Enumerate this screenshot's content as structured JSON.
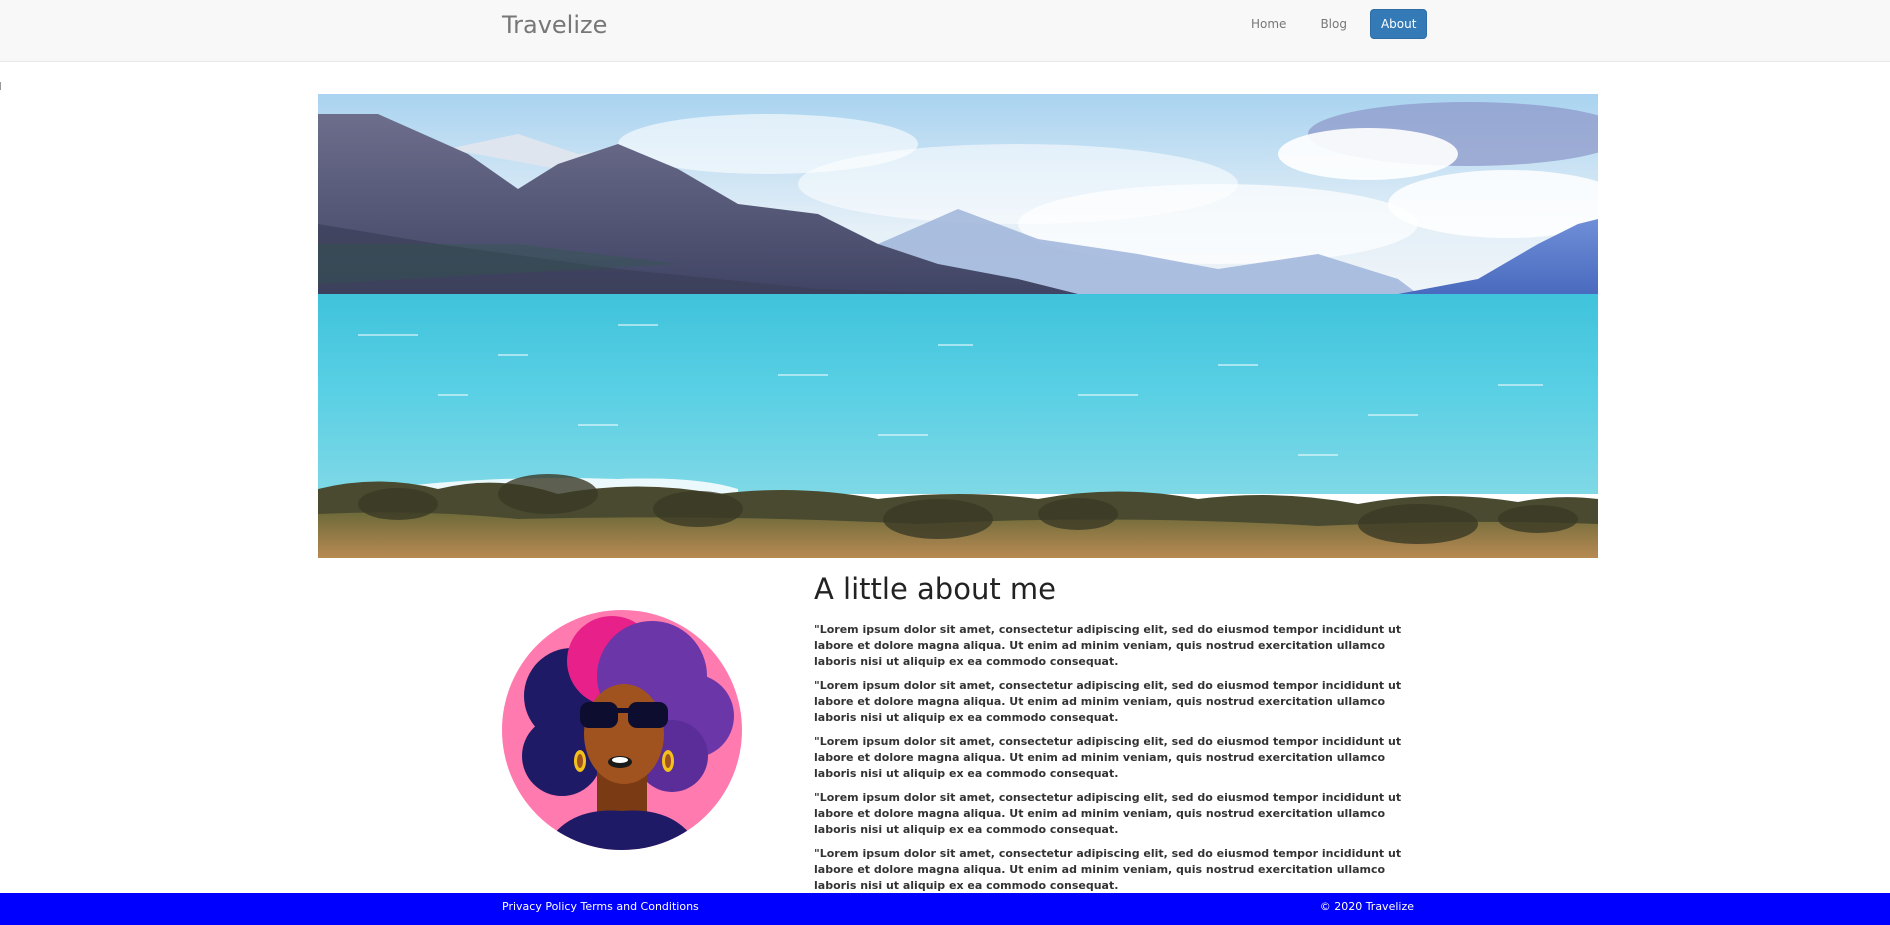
{
  "navbar": {
    "brand": "Travelize",
    "links": [
      "Home",
      "Blog",
      "About"
    ]
  },
  "about": {
    "title": "A little about me",
    "paragraphs": [
      "\"Lorem ipsum dolor sit amet, consectetur adipiscing elit, sed do eiusmod tempor incididunt ut labore et dolore magna aliqua. Ut enim ad minim veniam, quis nostrud exercitation ullamco laboris nisi ut aliquip ex ea commodo consequat.",
      "\"Lorem ipsum dolor sit amet, consectetur adipiscing elit, sed do eiusmod tempor incididunt ut labore et dolore magna aliqua. Ut enim ad minim veniam, quis nostrud exercitation ullamco laboris nisi ut aliquip ex ea commodo consequat.",
      "\"Lorem ipsum dolor sit amet, consectetur adipiscing elit, sed do eiusmod tempor incididunt ut labore et dolore magna aliqua. Ut enim ad minim veniam, quis nostrud exercitation ullamco laboris nisi ut aliquip ex ea commodo consequat.",
      "\"Lorem ipsum dolor sit amet, consectetur adipiscing elit, sed do eiusmod tempor incididunt ut labore et dolore magna aliqua. Ut enim ad minim veniam, quis nostrud exercitation ullamco laboris nisi ut aliquip ex ea commodo consequat.",
      "\"Lorem ipsum dolor sit amet, consectetur adipiscing elit, sed do eiusmod tempor incididunt ut labore et dolore magna aliqua. Ut enim ad minim veniam, quis nostrud exercitation ullamco laboris nisi ut aliquip ex ea commodo consequat."
    ]
  },
  "footer": {
    "privacy": "Privacy Policy",
    "terms": "Terms and Conditions",
    "copyright": "© 2020 Travelize"
  },
  "colors": {
    "nav_active": "#337ab7",
    "footer_bg": "#0000ff",
    "navbar_bg": "#f8f8f8"
  },
  "images": {
    "hero": "lake-mountains-landscape",
    "avatar": "woman-sunglasses-illustration"
  }
}
